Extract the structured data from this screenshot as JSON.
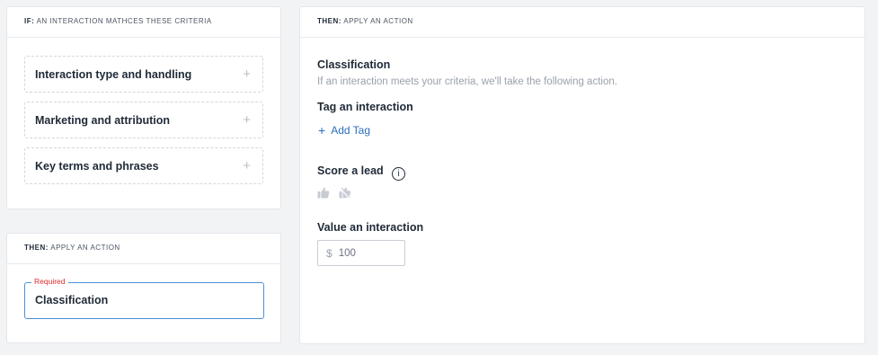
{
  "criteria_panel": {
    "header_prefix": "IF:",
    "header_text": "AN INTERACTION MATHCES THESE CRITERIA",
    "items": [
      {
        "label": "Interaction type and handling",
        "icon": "plus-icon"
      },
      {
        "label": "Marketing and attribution",
        "icon": "plus-icon"
      },
      {
        "label": "Key terms and phrases",
        "icon": "plus-icon"
      }
    ]
  },
  "action_panel_left": {
    "header_prefix": "THEN:",
    "header_text": "APPLY AN ACTION",
    "field_legend": "Required",
    "field_value": "Classification"
  },
  "action_panel_right": {
    "header_prefix": "THEN:",
    "header_text": "APPLY AN ACTION",
    "classification_title": "Classification",
    "classification_subtitle": "If an interaction meets your criteria, we'll take the following action.",
    "tag_title": "Tag an interaction",
    "add_tag_label": "Add Tag",
    "score_title": "Score a lead",
    "info_icon_glyph": "i",
    "value_title": "Value an interaction",
    "value_currency": "$",
    "value_placeholder": "100"
  },
  "colors": {
    "accent_blue": "#4a90d9",
    "link_blue": "#2a6fbd",
    "required_red": "#d92d2d"
  }
}
